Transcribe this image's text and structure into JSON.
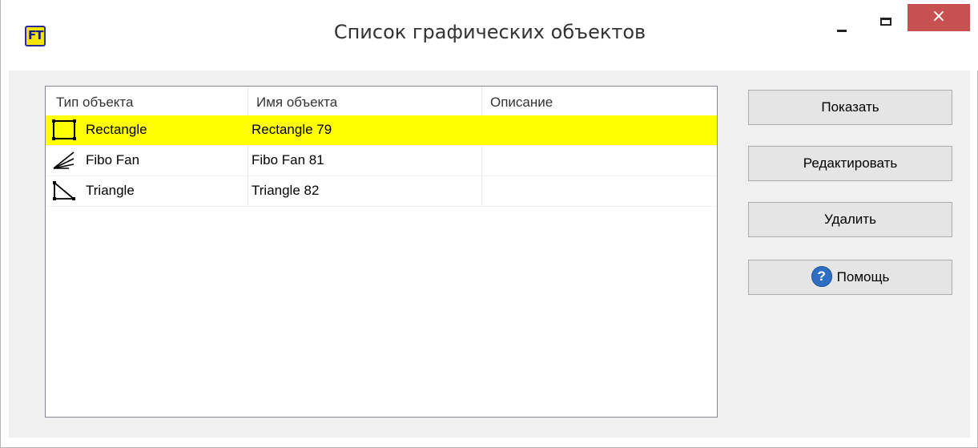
{
  "window": {
    "title": "Список графических объектов",
    "close_glyph": "×"
  },
  "table": {
    "columns": [
      "Тип объекта",
      "Имя объекта",
      "Описание"
    ],
    "rows": [
      {
        "type": "Rectangle",
        "name": "Rectangle 79",
        "description": "",
        "icon": "rectangle-icon",
        "selected": true
      },
      {
        "type": "Fibo Fan",
        "name": "Fibo Fan 81",
        "description": "",
        "icon": "fibo-fan-icon",
        "selected": false
      },
      {
        "type": "Triangle",
        "name": "Triangle 82",
        "description": "",
        "icon": "triangle-icon",
        "selected": false
      }
    ]
  },
  "buttons": {
    "show": "Показать",
    "edit": "Редактировать",
    "delete": "Удалить",
    "help": "Помощь",
    "help_glyph": "?"
  },
  "colors": {
    "selection": "#ffff00",
    "close_button": "#c75050",
    "help_icon": "#2e6fc4"
  }
}
